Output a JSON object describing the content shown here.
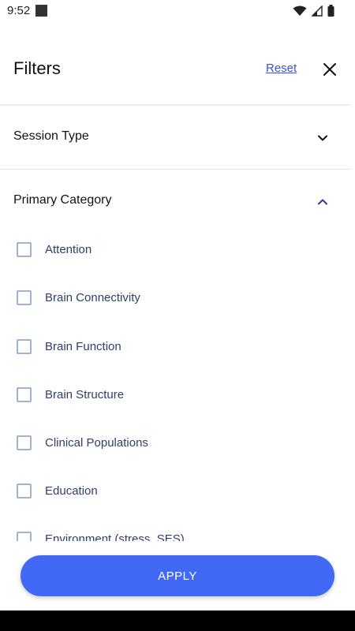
{
  "status_bar": {
    "time": "9:52"
  },
  "header": {
    "title": "Filters",
    "reset_label": "Reset"
  },
  "sections": [
    {
      "title": "Session Type",
      "expanded": false
    },
    {
      "title": "Primary Category",
      "expanded": true
    }
  ],
  "options": [
    {
      "label": "Attention",
      "checked": false
    },
    {
      "label": "Brain Connectivity",
      "checked": false
    },
    {
      "label": "Brain Function",
      "checked": false
    },
    {
      "label": "Brain Structure",
      "checked": false
    },
    {
      "label": "Clinical Populations",
      "checked": false
    },
    {
      "label": "Education",
      "checked": false
    },
    {
      "label": "Environment (stress, SES)",
      "checked": false
    }
  ],
  "footer": {
    "apply_label": "APPLY"
  },
  "colors": {
    "accent": "#4169f5",
    "link": "#3a54c8",
    "expanded_chevron": "#3d3590",
    "checkbox_border": "#9fb3d4",
    "option_text": "#2f4068"
  }
}
